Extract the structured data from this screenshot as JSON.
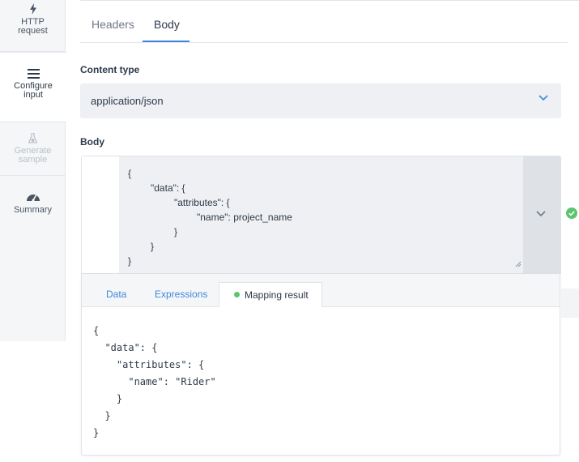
{
  "sidebar": {
    "steps": [
      {
        "label": "HTTP\nrequest",
        "icon": "lightning-icon"
      },
      {
        "label": "Configure\ninput",
        "icon": "menu-icon"
      },
      {
        "label": "Generate\nsample",
        "icon": "flask-icon"
      },
      {
        "label": "Summary",
        "icon": "gauge-icon"
      }
    ]
  },
  "tabs": {
    "headers": "Headers",
    "body": "Body"
  },
  "content_type": {
    "label": "Content type",
    "value": "application/json"
  },
  "body": {
    "label": "Body",
    "lines": [
      "{",
      "\"data\": {",
      "\"attributes\": {",
      "\"name\": project_name",
      "}",
      "}",
      "}"
    ],
    "status_icon": "check-circle-icon"
  },
  "mapping": {
    "tabs": {
      "data": "Data",
      "expressions": "Expressions",
      "result": "Mapping result"
    },
    "lines": [
      "{",
      "  \"data\": {",
      "    \"attributes\": {",
      "      \"name\": \"Rider\"",
      "    }",
      "  }",
      "}"
    ]
  },
  "colors": {
    "accent": "#3d87de",
    "success": "#5cc56e"
  }
}
